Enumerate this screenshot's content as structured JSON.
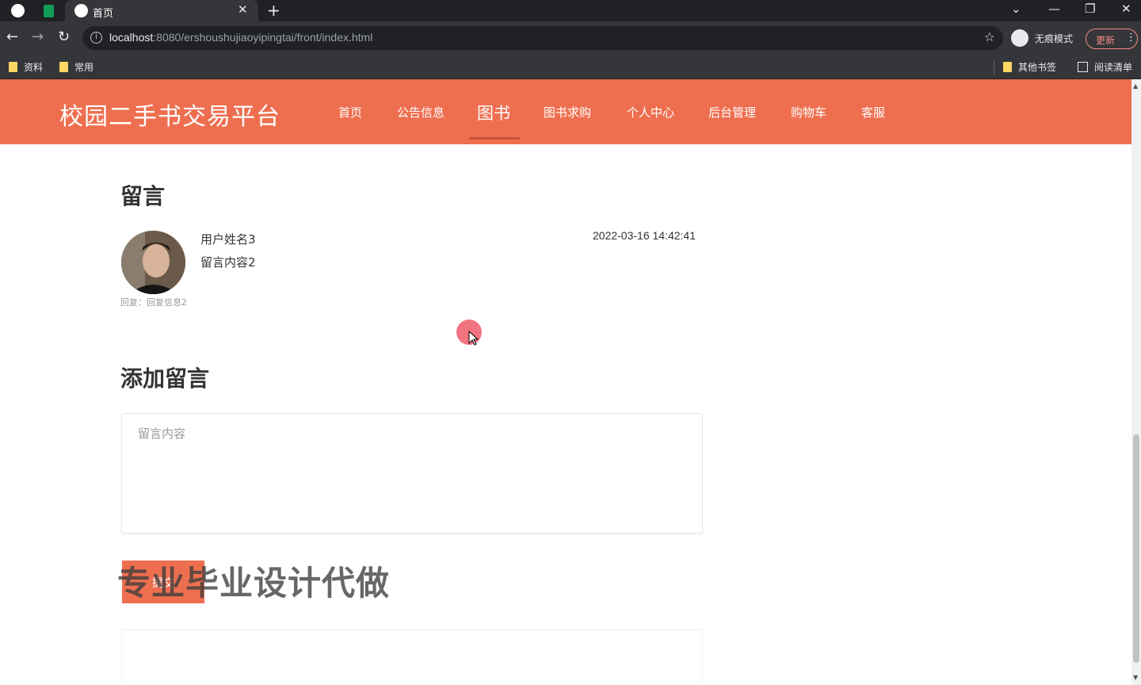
{
  "browser": {
    "tab_title": "首页",
    "url_host": "localhost",
    "url_rest": ":8080/ershoushujiaoyipingtai/front/index.html",
    "incognito_label": "无痕模式",
    "update_label": "更新",
    "bookmarks": [
      "资料",
      "常用"
    ],
    "other_bookmarks": "其他书签",
    "reading_list": "阅读清单"
  },
  "header": {
    "site_title": "校园二手书交易平台",
    "nav": [
      "首页",
      "公告信息",
      "图书",
      "图书求购",
      "个人中心",
      "后台管理",
      "购物车",
      "客服"
    ],
    "active_nav": "图书"
  },
  "comments": {
    "title": "留言",
    "items": [
      {
        "user": "用户姓名3",
        "content": "留言内容2",
        "time": "2022-03-16 14:42:41",
        "reply": "回复：回复信息2"
      }
    ]
  },
  "add_comment": {
    "title": "添加留言",
    "placeholder": "留言内容",
    "submit_label": "提交"
  },
  "watermark": "专业毕业设计代做",
  "colors": {
    "accent": "#ee6f50",
    "tab_bar": "#202124",
    "toolbar": "#35363a"
  }
}
